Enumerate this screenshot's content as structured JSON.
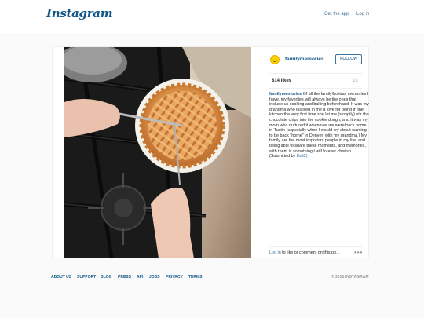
{
  "header": {
    "logo": "Instagram",
    "get_app_label": "Get the app",
    "login_label": "Log in"
  },
  "post": {
    "username": "familymemories",
    "follow_label": "FOLLOW",
    "likes": "814 likes",
    "age": "1h",
    "caption_user": "familymemories",
    "caption_text": "Of all the family/holiday memories I have, my favorites will always be the ones that include us cooking and baking beforehand. It was my grandma who instilled in me a love for being in the kitchen the very first time she let me (sloppily) stir the chocolate chips into the cookie dough, and it was my mom who nurtured it whenever we were back home in Tustin (especially when I would cry about wanting to be back \"home\" in Denver, with my grandma.) My family are the most important people in my life, and being able to share these moments, and memories, with them is something I will forever cherish. (Submitted by",
    "caption_tail": "Keli2)",
    "login_link": "Log in",
    "login_rest": " to like or comment on this po...",
    "more": "•••",
    "colors": {
      "link": "#125688",
      "button": "#3f729b",
      "avatar": "#f7d000"
    }
  },
  "footer": {
    "links": [
      "ABOUT US",
      "SUPPORT",
      "BLOG",
      "PRESS",
      "API",
      "JOBS",
      "PRIVACY",
      "TERMS"
    ],
    "copyright": "© 2015 INSTAGRAM"
  }
}
